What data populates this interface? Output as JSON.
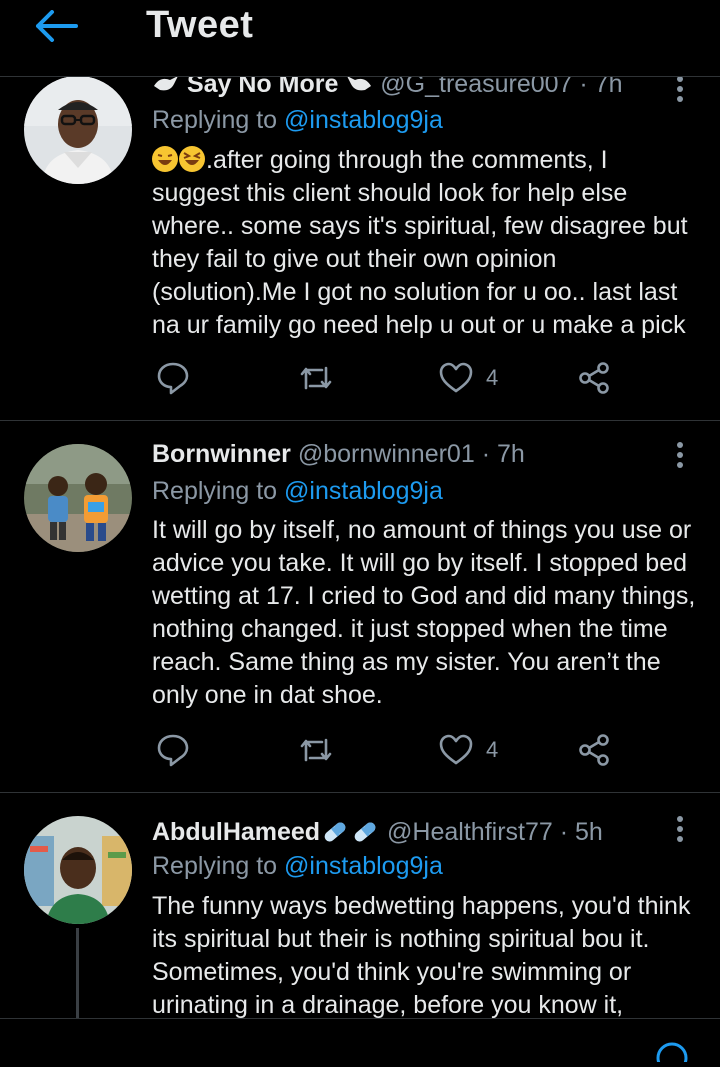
{
  "header": {
    "title": "Tweet"
  },
  "tweets": [
    {
      "name": "Say No More",
      "handle": "@G_treasure007",
      "time": "· 7h",
      "replying_prefix": "Replying to ",
      "replying_to": "@instablog9ja",
      "text": ".after going through the comments, I suggest this client should look for help else where.. some says it's spiritual, few disagree but they fail to give out their own opinion (solution).Me I got no solution for u oo.. last last na ur family go need help u out or u make a pick",
      "likes": "4"
    },
    {
      "name": "Bornwinner",
      "handle": "@bornwinner01",
      "time": "· 7h",
      "replying_prefix": "Replying to ",
      "replying_to": "@instablog9ja",
      "text": "It will go by itself, no amount of things you use or advice you take. It will go by itself. I stopped bed wetting at 17. I cried to God and did many things, nothing changed. it just stopped when the time reach. Same thing as my sister. You aren’t the only one in dat shoe.",
      "likes": "4"
    },
    {
      "name": "AbdulHameed",
      "handle": "@Healthfirst77",
      "time": "· 5h",
      "replying_prefix": "Replying to ",
      "replying_to": "@instablog9ja",
      "text": "The funny ways bedwetting happens, you'd think its spiritual but their is nothing spiritual bou it. Sometimes, you'd think you're swimming or urinating in a drainage, before you know it,"
    }
  ],
  "colors": {
    "accent": "#1d9bf0",
    "muted": "#8b98a5",
    "text": "#e7e9ea",
    "divider": "#2f3336"
  },
  "icons": [
    "back-arrow-icon",
    "more-icon",
    "reply-icon",
    "retweet-icon",
    "like-icon",
    "share-icon",
    "pill-icon",
    "dove-icon",
    "grinning-emoji-icon"
  ]
}
